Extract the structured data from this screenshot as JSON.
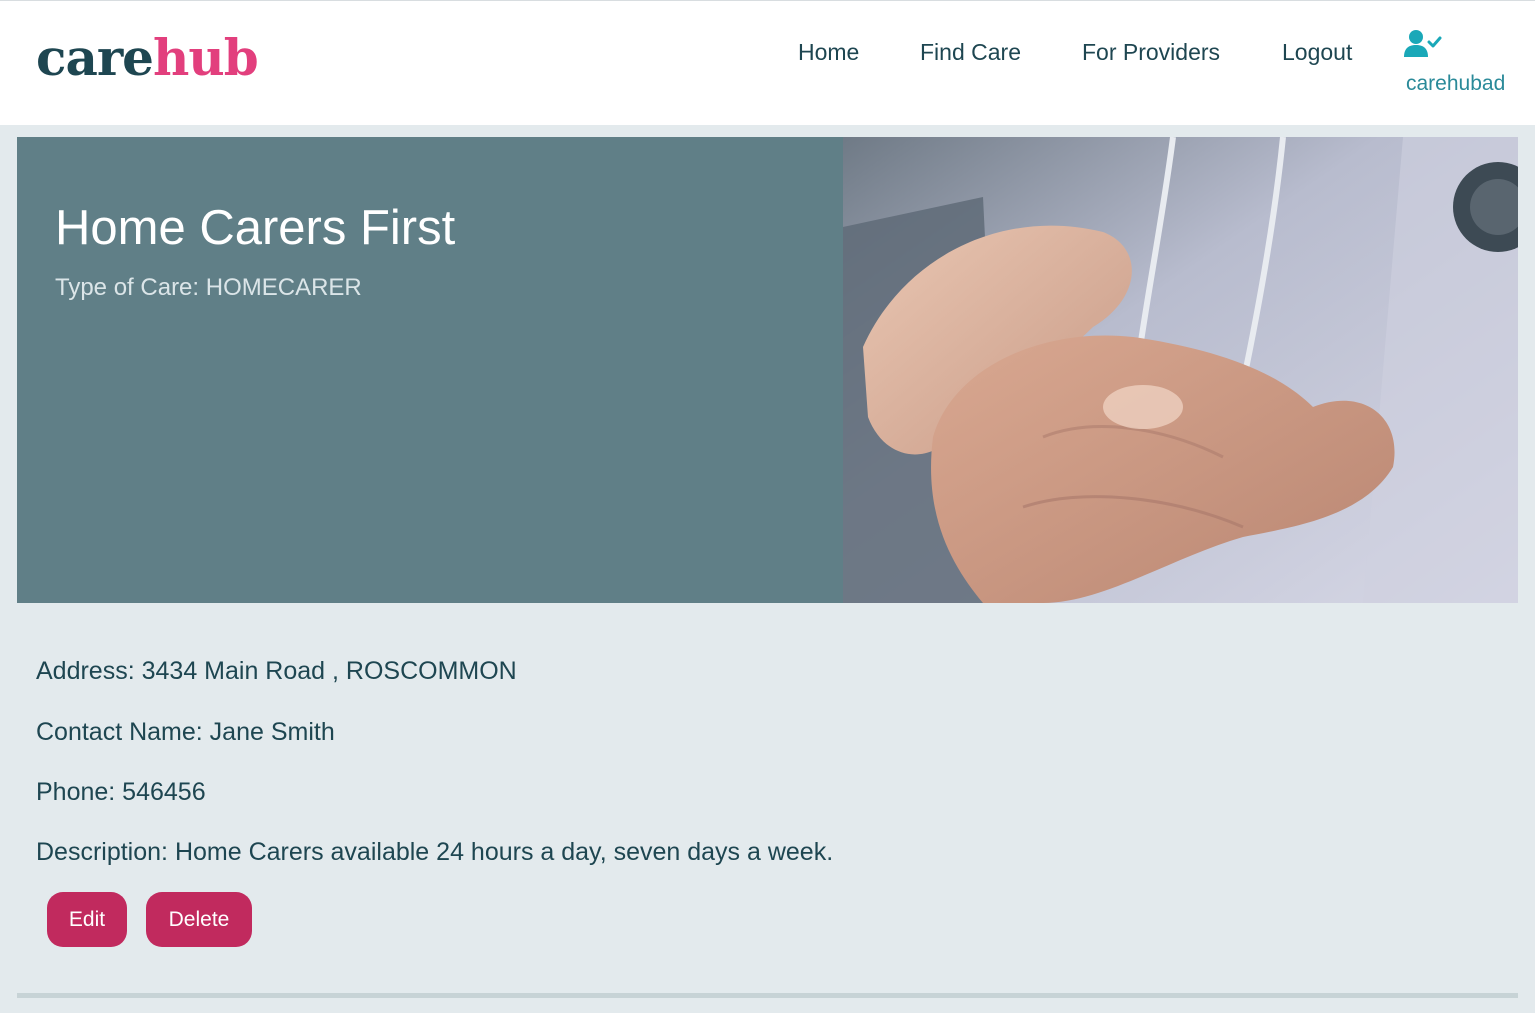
{
  "brand": {
    "part1": "care",
    "part2": "hub"
  },
  "nav": {
    "home": "Home",
    "find_care": "Find Care",
    "for_providers": "For Providers",
    "logout": "Logout",
    "user_icon": "user-check-icon",
    "username": "carehubad"
  },
  "provider": {
    "name": "Home Carers First",
    "type_line": "Type of Care: HOMECARER",
    "image": "caregiver-holding-elderly-hand-photo",
    "address": "Address: 3434 Main Road , ROSCOMMON",
    "contact": "Contact Name: Jane Smith",
    "phone": "Phone: 546456",
    "description": "Description: Home Carers available 24 hours a day, seven days a week."
  },
  "actions": {
    "edit": "Edit",
    "delete": "Delete"
  },
  "colors": {
    "brand_dark": "#1e4651",
    "brand_pink": "#e23f7d",
    "hero_bg": "#607f87",
    "button": "#c12a5e",
    "page_bg": "#e3eaed"
  }
}
